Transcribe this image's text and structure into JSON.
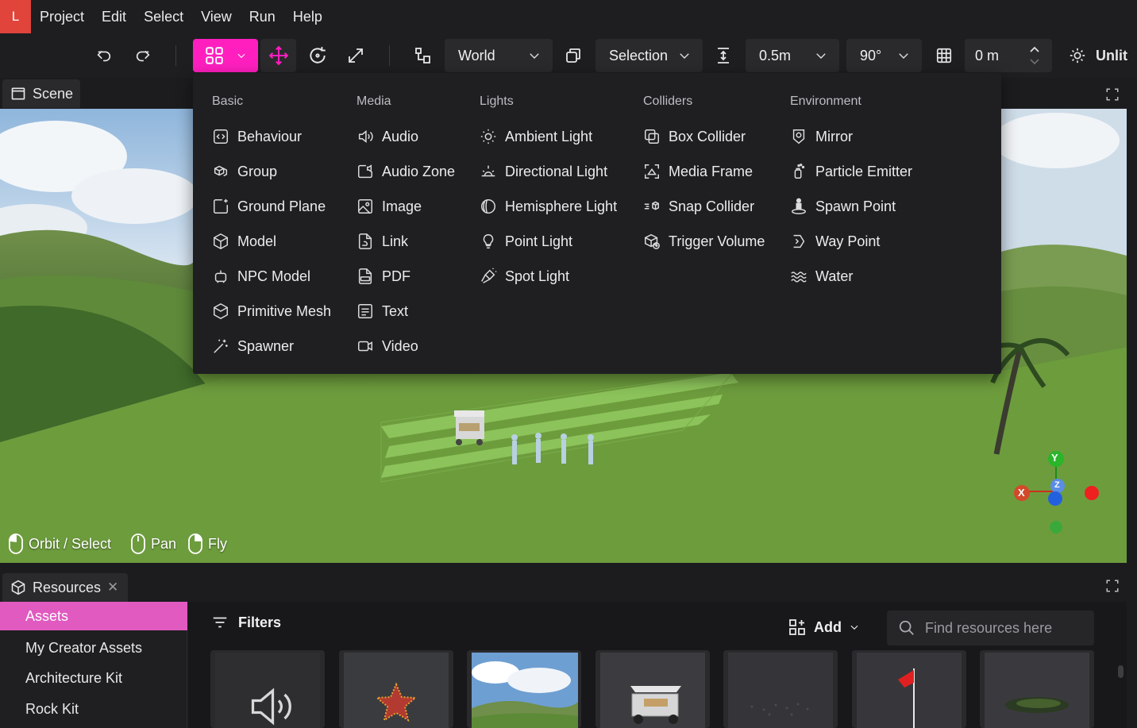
{
  "app": {
    "logo_letter": "L",
    "accent": "#e0443a",
    "highlight": "#ff1fbf"
  },
  "menubar": {
    "items": [
      "Project",
      "Edit",
      "Select",
      "View",
      "Run",
      "Help"
    ]
  },
  "toolbar": {
    "space_label": "World",
    "pivot_label": "Selection",
    "snap_label": "0.5m",
    "angle_label": "90°",
    "grid_label": "0 m",
    "lighting_label": "Unlit"
  },
  "scene": {
    "tab_label": "Scene",
    "hints": [
      {
        "label": "Orbit / Select"
      },
      {
        "label": "Pan"
      },
      {
        "label": "Fly"
      }
    ],
    "gizmo": {
      "y": "Y",
      "x": "X",
      "z": "Z"
    }
  },
  "add_menu": {
    "columns": [
      {
        "title": "Basic",
        "items": [
          {
            "label": "Behaviour",
            "icon": "code-box-icon"
          },
          {
            "label": "Group",
            "icon": "cubes-icon"
          },
          {
            "label": "Ground Plane",
            "icon": "plane-square-icon"
          },
          {
            "label": "Model",
            "icon": "cube-icon"
          },
          {
            "label": "NPC Model",
            "icon": "robot-icon"
          },
          {
            "label": "Primitive Mesh",
            "icon": "cube-outline-icon"
          },
          {
            "label": "Spawner",
            "icon": "magic-wand-icon"
          }
        ]
      },
      {
        "title": "Media",
        "items": [
          {
            "label": "Audio",
            "icon": "speaker-icon"
          },
          {
            "label": "Audio Zone",
            "icon": "audio-zone-icon"
          },
          {
            "label": "Image",
            "icon": "image-icon"
          },
          {
            "label": "Link",
            "icon": "link-file-icon"
          },
          {
            "label": "PDF",
            "icon": "pdf-icon"
          },
          {
            "label": "Text",
            "icon": "text-box-icon"
          },
          {
            "label": "Video",
            "icon": "video-icon"
          }
        ]
      },
      {
        "title": "Lights",
        "items": [
          {
            "label": "Ambient Light",
            "icon": "sun-icon"
          },
          {
            "label": "Directional Light",
            "icon": "directional-light-icon"
          },
          {
            "label": "Hemisphere Light",
            "icon": "hemisphere-icon"
          },
          {
            "label": "Point Light",
            "icon": "bulb-icon"
          },
          {
            "label": "Spot Light",
            "icon": "spotlight-icon"
          }
        ]
      },
      {
        "title": "Colliders",
        "items": [
          {
            "label": "Box Collider",
            "icon": "box-collider-icon"
          },
          {
            "label": "Media Frame",
            "icon": "media-frame-icon"
          },
          {
            "label": "Snap Collider",
            "icon": "snap-collider-icon"
          },
          {
            "label": "Trigger Volume",
            "icon": "trigger-volume-icon"
          }
        ]
      },
      {
        "title": "Environment",
        "items": [
          {
            "label": "Mirror",
            "icon": "mirror-icon"
          },
          {
            "label": "Particle Emitter",
            "icon": "particle-icon"
          },
          {
            "label": "Spawn Point",
            "icon": "spawn-point-icon"
          },
          {
            "label": "Way Point",
            "icon": "way-point-icon"
          },
          {
            "label": "Water",
            "icon": "water-icon"
          }
        ]
      }
    ]
  },
  "resources": {
    "tab_label": "Resources",
    "close_symbol": "✕",
    "sidebar": [
      {
        "label": "Assets",
        "active": true
      },
      {
        "label": "My Creator Assets",
        "active": false
      },
      {
        "label": "Architecture Kit",
        "active": false
      },
      {
        "label": "Rock Kit",
        "active": false
      }
    ],
    "filters_label": "Filters",
    "add_label": "Add",
    "search_placeholder": "Find resources here",
    "cards": [
      {
        "name": "audio-card",
        "kind": "speaker-icon"
      },
      {
        "name": "star-model-card",
        "kind": "star-thumbnail"
      },
      {
        "name": "skybox-card",
        "kind": "sky-thumbnail"
      },
      {
        "name": "golf-cart-card",
        "kind": "cart-thumbnail"
      },
      {
        "name": "particles-card",
        "kind": "dots-thumbnail"
      },
      {
        "name": "flag-card",
        "kind": "flag-thumbnail"
      },
      {
        "name": "island-card",
        "kind": "island-thumbnail"
      }
    ]
  }
}
